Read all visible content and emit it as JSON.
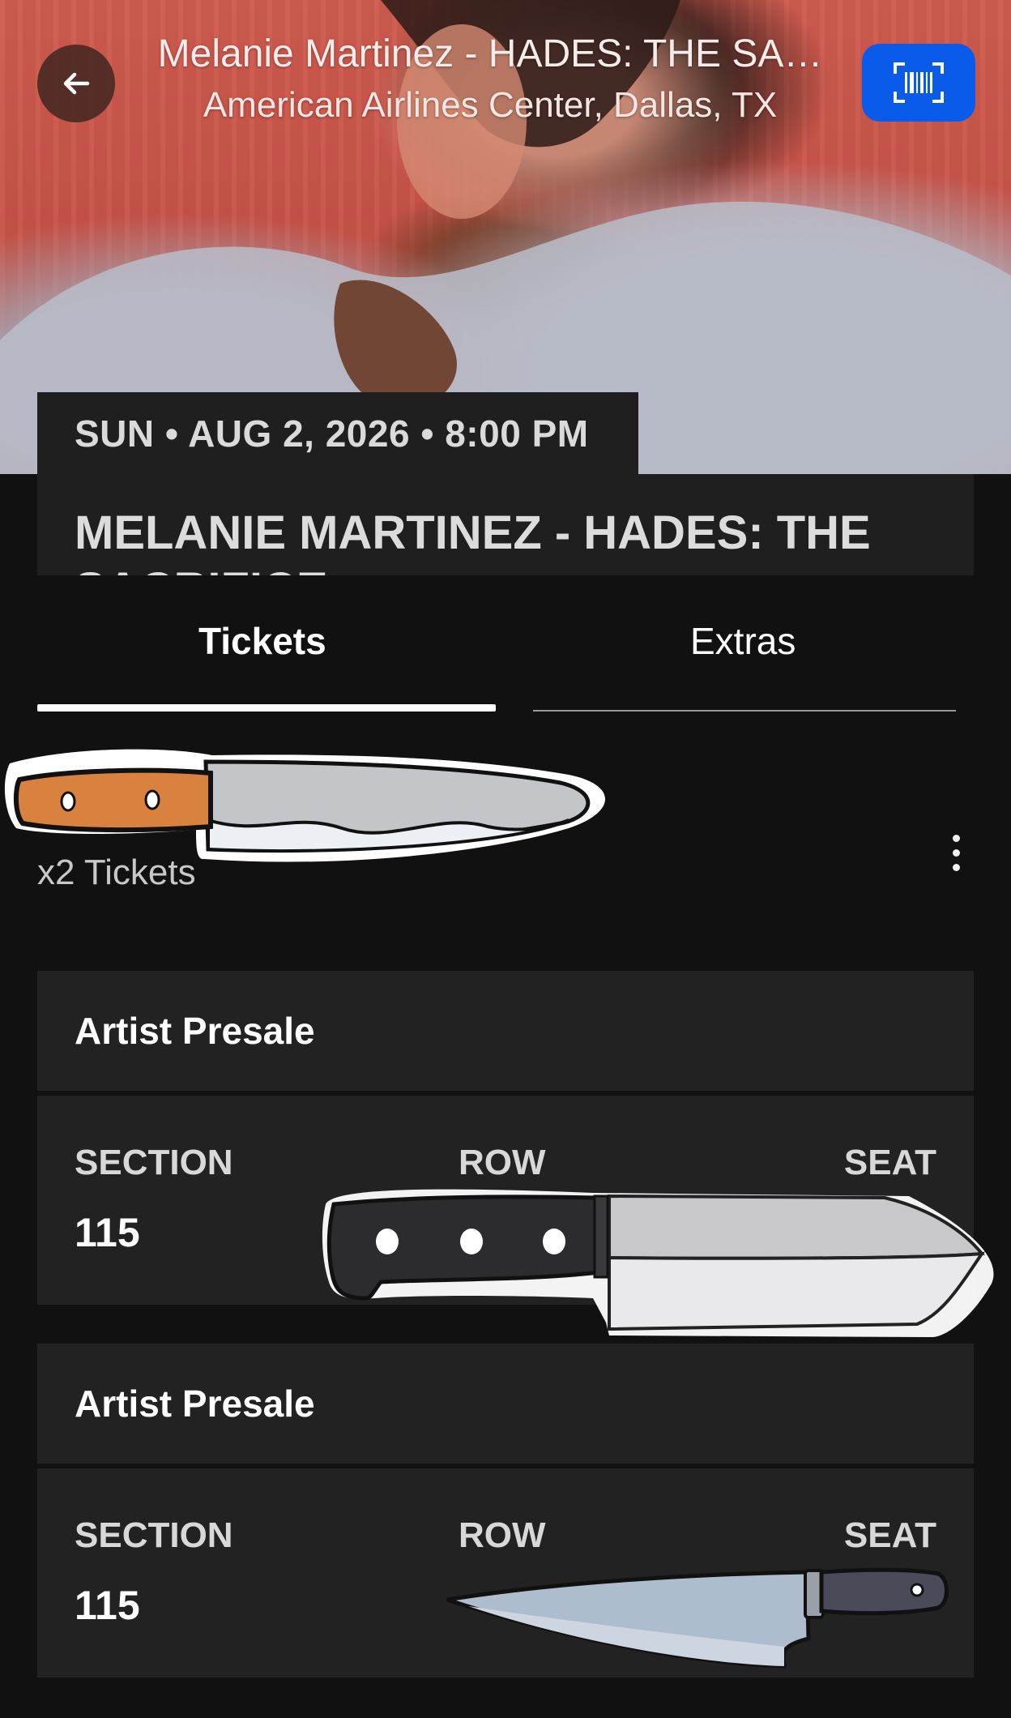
{
  "header": {
    "title": "Melanie Martinez - HADES: THE SA…",
    "venue": "American Airlines Center, Dallas, TX"
  },
  "event": {
    "date_line": "SUN • AUG 2, 2026 • 8:00 PM",
    "name": "MELANIE MARTINEZ - HADES: THE SACRIFICE"
  },
  "tabs": [
    {
      "label": "Tickets",
      "active": true
    },
    {
      "label": "Extras",
      "active": false
    }
  ],
  "ticket_count": "x2 Tickets",
  "tickets": [
    {
      "type": "Artist Presale",
      "section_label": "SECTION",
      "section": "115",
      "row_label": "ROW",
      "seat_label": "SEAT"
    },
    {
      "type": "Artist Presale",
      "section_label": "SECTION",
      "section": "115",
      "row_label": "ROW",
      "seat_label": "SEAT"
    }
  ],
  "icons": {
    "back": "arrow-left-icon",
    "barcode": "barcode-scan-icon",
    "more": "more-vertical-icon",
    "stickers": [
      "knife-sticker",
      "knife-sticker",
      "knife-sticker"
    ]
  },
  "colors": {
    "background": "#111111",
    "card": "#222222",
    "barcode_button": "#0a5be9",
    "hero": "#cf5b4f"
  }
}
